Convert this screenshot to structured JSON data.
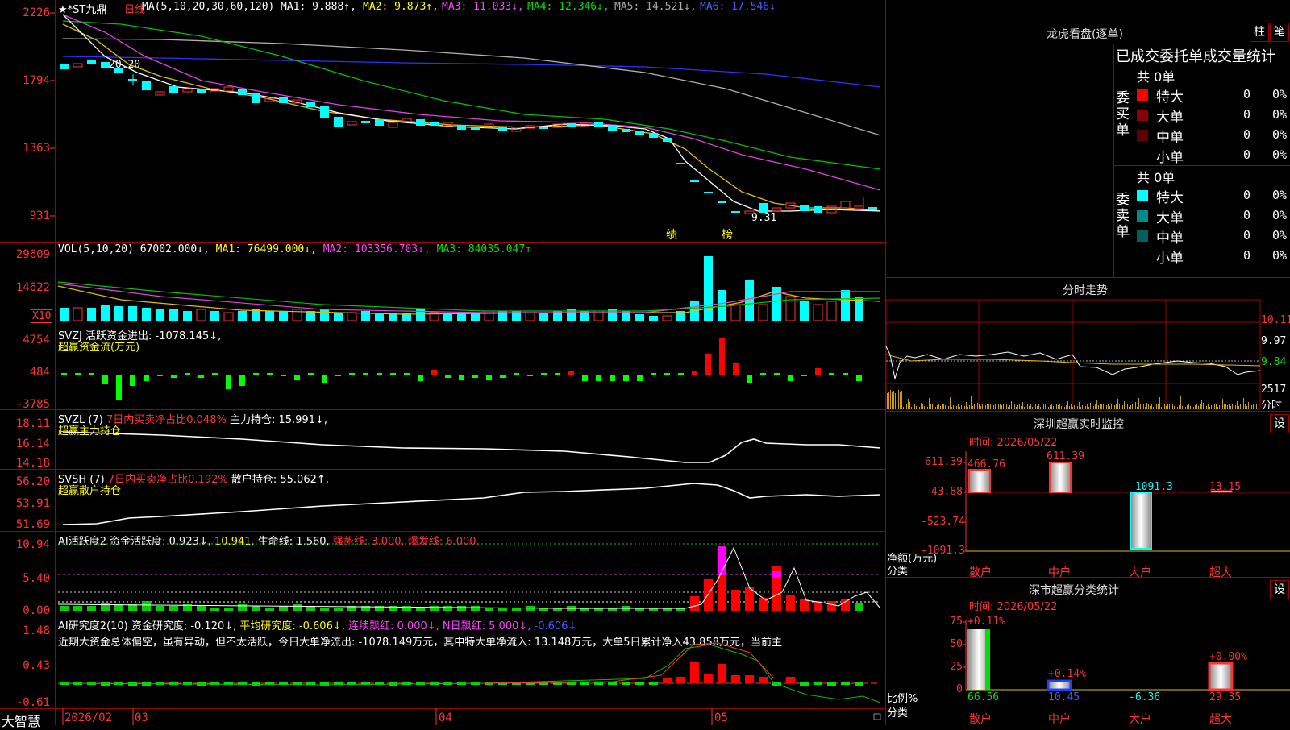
{
  "main_chart": {
    "name": "★*ST九鼎",
    "period": "日线",
    "ma_label": "MA(5,10,20,30,60,120)",
    "ma1": "MA1: 9.888↑,",
    "ma2": "MA2: 9.873↑,",
    "ma3": "MA3: 11.033↓,",
    "ma4": "MA4: 12.346↓,",
    "ma5": "MA5: 14.521↓,",
    "ma6": "MA6: 17.546↓",
    "y_ticks": [
      "2226",
      "1794",
      "1363",
      "931"
    ],
    "high_label": "20.20",
    "low_label": "9.31",
    "tag1": "绩",
    "tag2": "榜"
  },
  "vol_panel": {
    "label": "VOL(5,10,20)",
    "v": "67002.000↓,",
    "ma1": "MA1: 76499.000↓,",
    "ma2": "MA2: 103356.703↓,",
    "ma3": "MA3: 84035.047↑",
    "y_ticks": [
      "29609",
      "14622"
    ],
    "unit": "X10"
  },
  "svzj_panel": {
    "label": "SVZJ  活跃资金进出: -1078.145↓,",
    "sub": "超赢资金流(万元)",
    "y_ticks": [
      "4754",
      "484",
      "-3785"
    ]
  },
  "svzl_panel": {
    "label": "SVZL (7)",
    "ratio": "7日内买卖净占比0.048%",
    "hold": "主力持仓: 15.991↓,",
    "sub": "超赢主力持仓",
    "y_ticks": [
      "18.11",
      "16.14",
      "14.18"
    ]
  },
  "svsh_panel": {
    "label": "SVSH (7)",
    "ratio": "7日内买卖净占比0.192%",
    "hold": "散户持仓: 55.062↑,",
    "sub": "超赢散户持仓",
    "y_ticks": [
      "56.20",
      "53.91",
      "51.69"
    ]
  },
  "ai_active_panel": {
    "label": "AI活跃度2 资金活跃度: 0.923↓,",
    "v2": "10.941,",
    "life": "生命线: 1.560,",
    "strong": "强势线: 3.000,",
    "burst": "爆发线: 6.000,",
    "y_ticks": [
      "10.94",
      "5.40",
      "0.00"
    ]
  },
  "ai_research_panel": {
    "label": "AI研究度2(10)",
    "res": "资金研究度: -0.120↓,",
    "avg": "平均研究度: -0.606↓,",
    "red": "连续飘红: 0.000↓,",
    "nred": "N日飘红: 5.000↓,",
    "last": "-0.606↓",
    "comment": "近期大资金总体偏空，虽有异动，但不太活跃，今日大单净流出: -1078.149万元，其中特大单净流入: 13.148万元，大单5日累计净入43.858万元，当前主",
    "y_ticks": [
      "1.48",
      "0.43",
      "-0.61"
    ]
  },
  "date_axis": {
    "brand": "大智慧",
    "labels": [
      "2026/02",
      "03",
      "04",
      "05"
    ]
  },
  "dragon_tiger": {
    "title": "龙虎看盘(逐单)",
    "btn1": "柱",
    "btn2": "笔",
    "header": "已成交委托单成交量统计",
    "buy": {
      "side": "委买单",
      "total": "共 0单",
      "rows": [
        {
          "label": "特大",
          "count": "0",
          "pct": "0%",
          "color": "#ff0000"
        },
        {
          "label": "大单",
          "count": "0",
          "pct": "0%",
          "color": "#8b0000"
        },
        {
          "label": "中单",
          "count": "0",
          "pct": "0%",
          "color": "#600000"
        },
        {
          "label": "小单",
          "count": "0",
          "pct": "0%",
          "color": ""
        }
      ]
    },
    "sell": {
      "side": "委卖单",
      "total": "共 0单",
      "rows": [
        {
          "label": "特大",
          "count": "0",
          "pct": "0%",
          "color": "#00ffff"
        },
        {
          "label": "大单",
          "count": "0",
          "pct": "0%",
          "color": "#008b8b"
        },
        {
          "label": "中单",
          "count": "0",
          "pct": "0%",
          "color": "#006060"
        },
        {
          "label": "小单",
          "count": "0",
          "pct": "0%",
          "color": ""
        }
      ]
    }
  },
  "intraday": {
    "title": "分时走势",
    "prices": [
      "10.11",
      "9.97",
      "9.84"
    ],
    "vol": "2517",
    "vol_unit": "分时"
  },
  "monitor": {
    "title": "深圳超赢实时监控",
    "btn": "设",
    "time": "时间: 2026/05/22",
    "y_ticks": [
      "611.39",
      "43.88",
      "-523.74",
      "-1091.3"
    ],
    "ylabel": "净额(万元)",
    "xlabel": "分类",
    "cats": [
      "散户",
      "中户",
      "大户",
      "超大"
    ],
    "values": [
      "466.76",
      "611.39",
      "-1091.3",
      "13.15"
    ]
  },
  "classify": {
    "title": "深市超赢分类统计",
    "btn": "设",
    "time": "时间: 2026/05/22",
    "y_ticks": [
      "75",
      "50",
      "25",
      "0"
    ],
    "ylabel": "比例%",
    "xlabel": "分类",
    "cats": [
      "散户",
      "中户",
      "大户",
      "超大"
    ],
    "top": [
      "+0.11%",
      "+0.14%",
      "",
      "+0.00%"
    ],
    "values": [
      "66.56",
      "10.45",
      "-6.36",
      "29.35"
    ]
  }
}
